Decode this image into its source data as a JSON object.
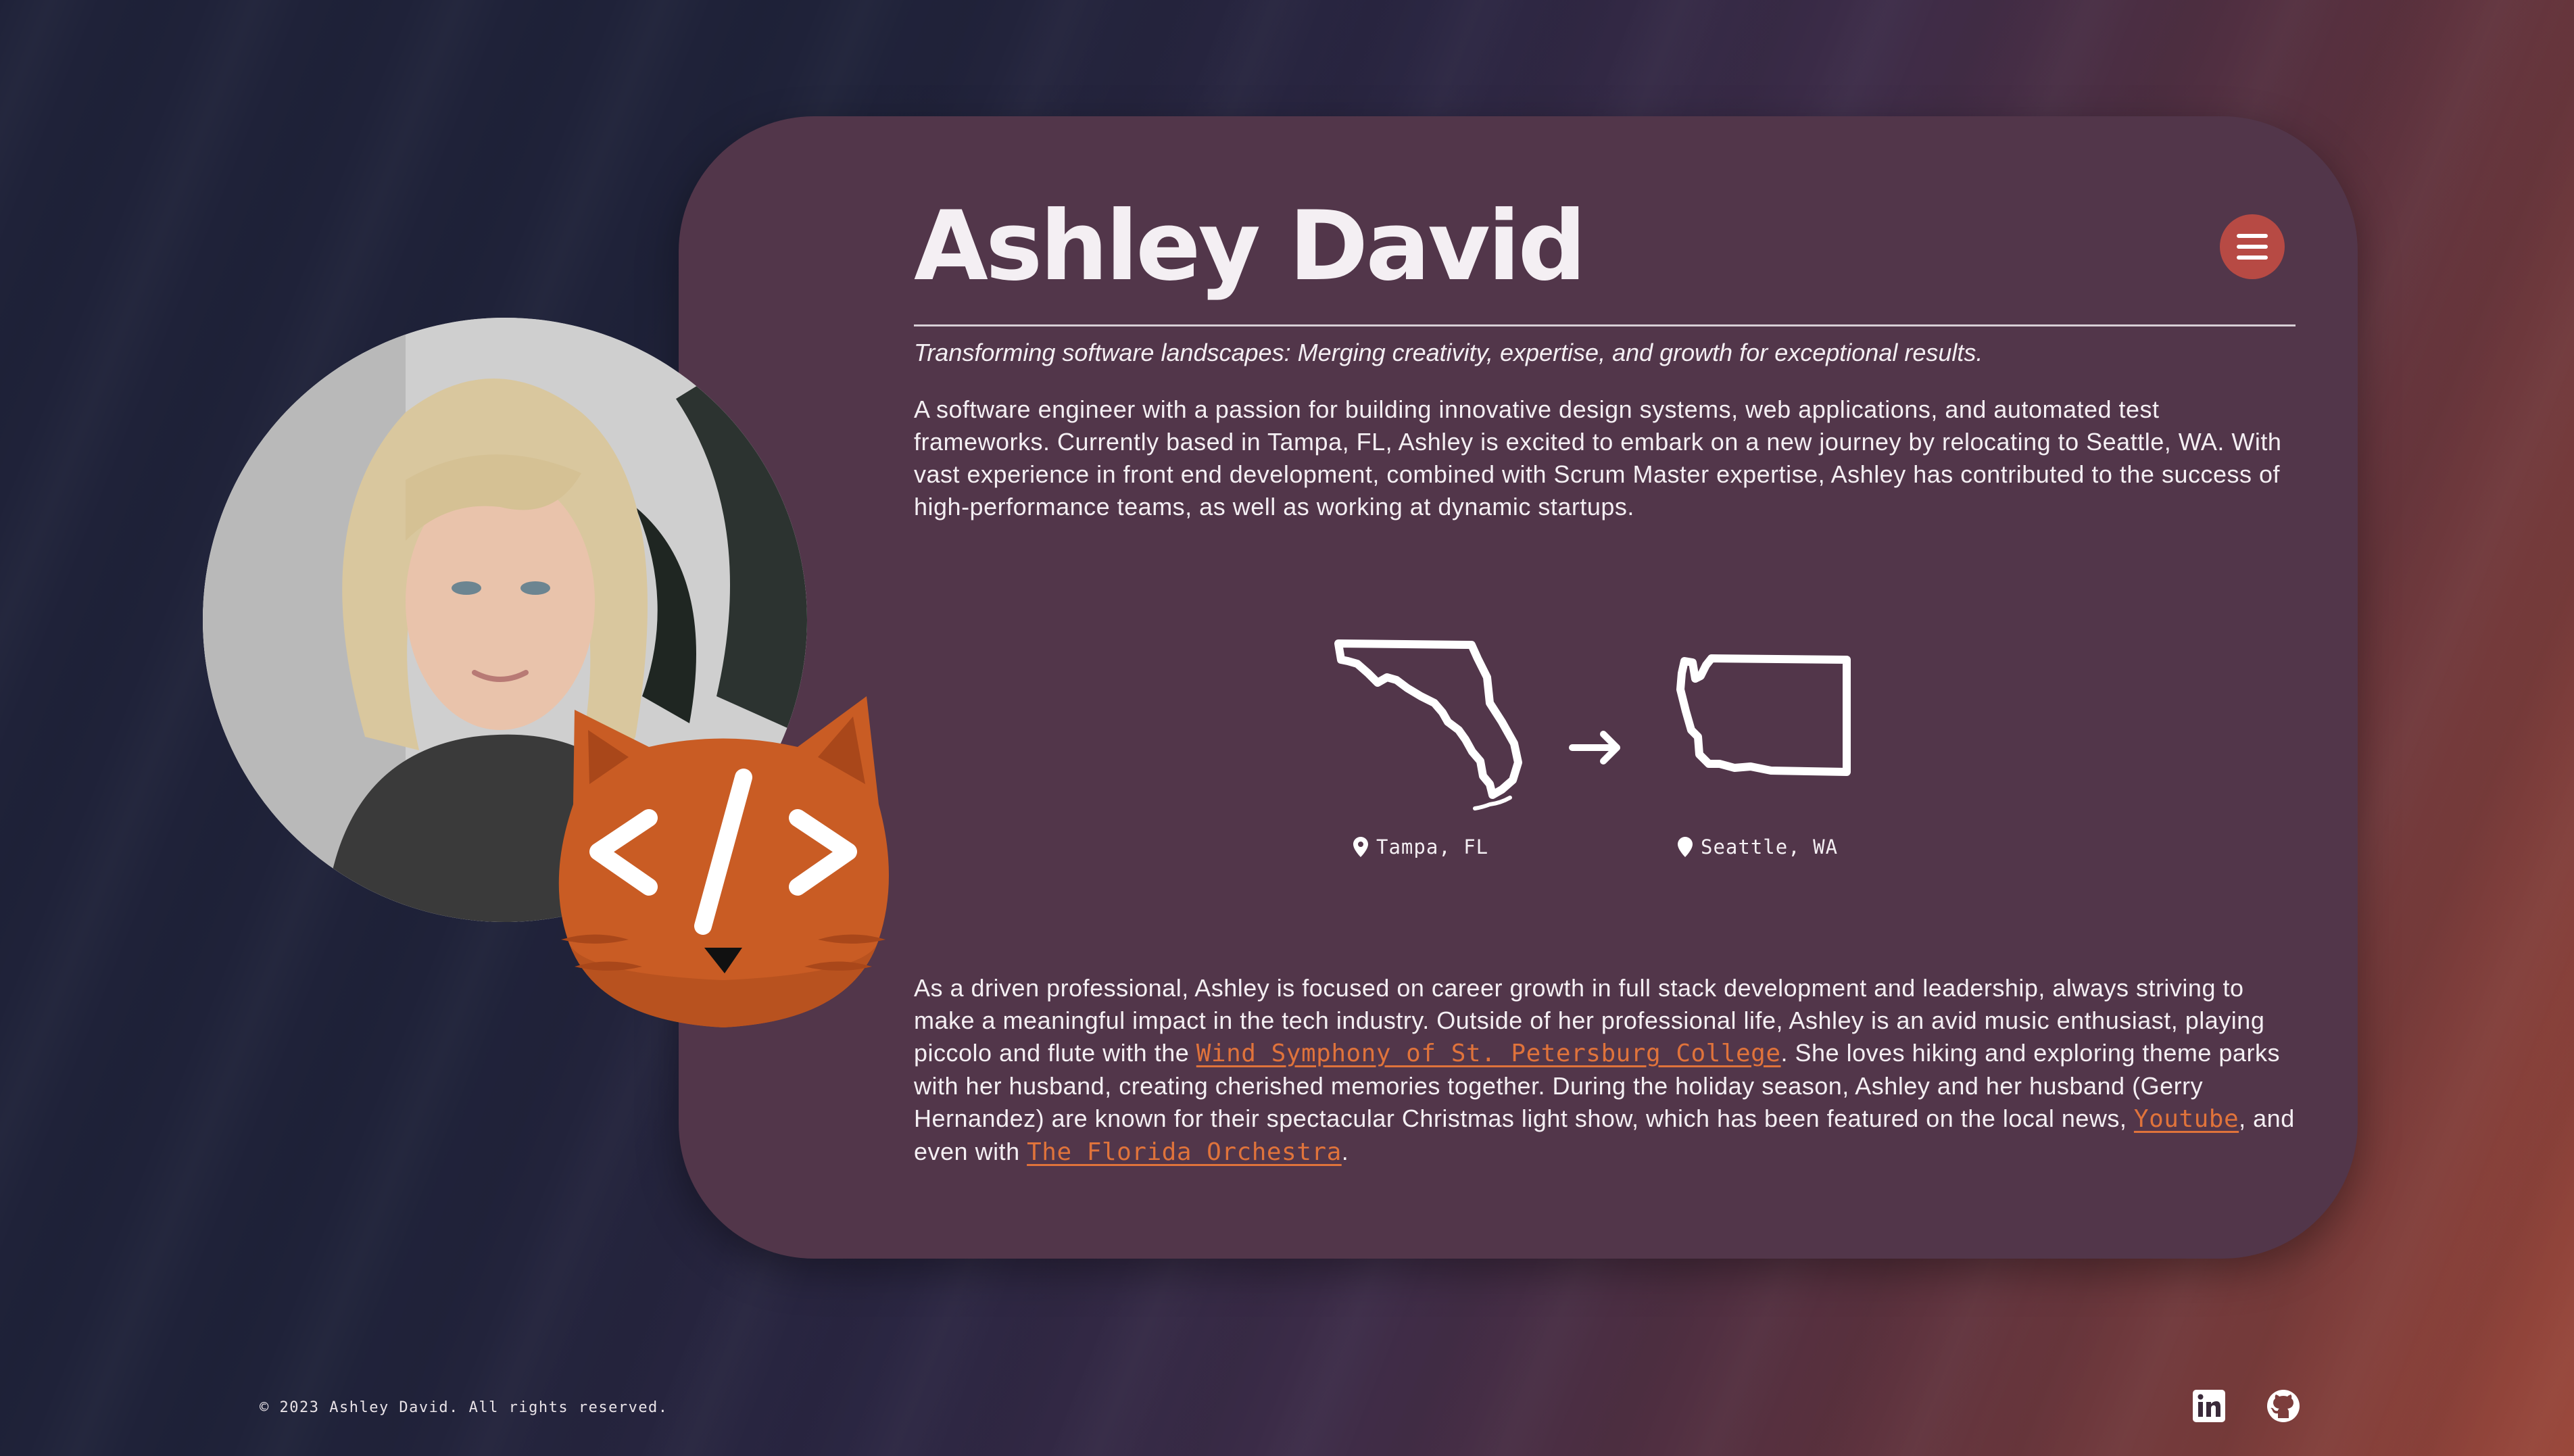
{
  "header": {
    "title": "Ashley David",
    "menu_icon": "hamburger-menu-icon"
  },
  "tagline": "Transforming software landscapes: Merging creativity, expertise, and growth for exceptional results.",
  "intro": "A software engineer with a passion for building innovative design systems, web applications, and automated test frameworks. Currently based in Tampa, FL, Ashley is excited to embark on a new journey by relocating to Seattle, WA. With vast experience in front end development, combined with Scrum Master expertise, Ashley has contributed to the success of high-performance teams, as well as working at dynamic startups.",
  "relocation": {
    "from": "Tampa, FL",
    "to": "Seattle, WA",
    "from_icon": "florida-map-icon",
    "to_icon": "washington-map-icon",
    "arrow_icon": "arrow-right-icon",
    "pin_icon": "location-pin-icon"
  },
  "about": {
    "part1": "As a driven professional, Ashley is focused on career growth in full stack development and leadership, always striving to make a meaningful impact in the tech industry. Outside of her professional life, Ashley is an avid music enthusiast, playing piccolo and flute with the ",
    "link1": "Wind Symphony of St. Petersburg College",
    "part2": ". She loves hiking and exploring theme parks with her husband, creating cherished memories together. During the holiday season, Ashley and her husband (Gerry Hernandez) are known for their spectacular Christmas light show, which has been featured on the local news, ",
    "link2": "Youtube",
    "part3": ", and even with ",
    "link3": "The Florida Orchestra",
    "part4": "."
  },
  "footer": {
    "copyright": "© 2023 Ashley David. All rights reserved.",
    "linkedin_icon": "linkedin-icon",
    "github_icon": "github-icon"
  },
  "colors": {
    "card": "#52364a",
    "accent": "#b74a44",
    "link": "#e0733b",
    "cat": "#c95c24"
  }
}
